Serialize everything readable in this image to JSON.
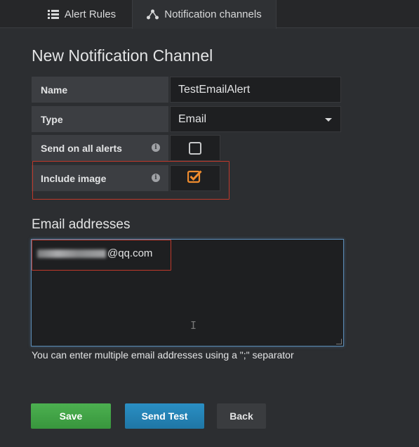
{
  "tabs": [
    {
      "label": "Alert Rules",
      "icon": "list-icon"
    },
    {
      "label": "Notification channels",
      "icon": "share-icon"
    }
  ],
  "page_title": "New Notification Channel",
  "form": {
    "name_label": "Name",
    "name_value": "TestEmailAlert",
    "type_label": "Type",
    "type_value": "Email",
    "send_all_label": "Send on all alerts",
    "send_all_checked": false,
    "include_image_label": "Include image",
    "include_image_checked": true,
    "info_glyph": "i"
  },
  "email": {
    "section_title": "Email addresses",
    "value_visible_suffix": "@qq.com",
    "help_text": "You can enter multiple email addresses using a \";\" separator"
  },
  "buttons": {
    "save": "Save",
    "send_test": "Send Test",
    "back": "Back"
  },
  "colors": {
    "checkbox_accent": "#f08c2e",
    "highlight": "#c0392b",
    "save": "#4cb050",
    "send_test": "#2a8fc4"
  }
}
